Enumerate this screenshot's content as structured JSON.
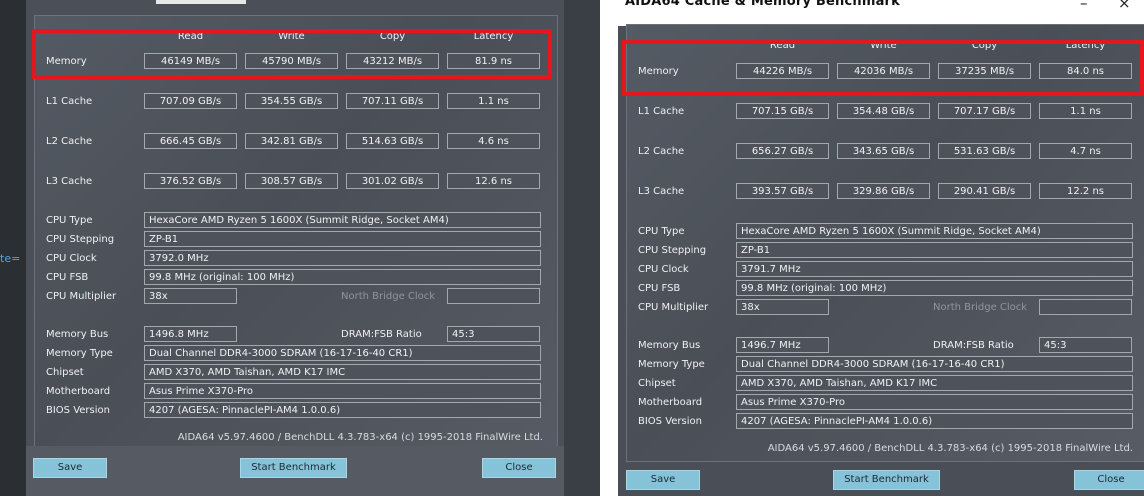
{
  "window": {
    "title": "AIDA64 Cache & Memory Benchmark",
    "minimize": "–",
    "close": "×"
  },
  "left_gutter_text": "te=",
  "columns": [
    "Read",
    "Write",
    "Copy",
    "Latency"
  ],
  "row_labels": [
    "Memory",
    "L1 Cache",
    "L2 Cache",
    "L3 Cache"
  ],
  "info_labels": {
    "cpu_type": "CPU Type",
    "cpu_stepping": "CPU Stepping",
    "cpu_clock": "CPU Clock",
    "cpu_fsb": "CPU FSB",
    "cpu_multiplier": "CPU Multiplier",
    "north_bridge_clock": "North Bridge Clock",
    "memory_bus": "Memory Bus",
    "dram_fsb_ratio": "DRAM:FSB Ratio",
    "memory_type": "Memory Type",
    "chipset": "Chipset",
    "motherboard": "Motherboard",
    "bios_version": "BIOS Version"
  },
  "buttons": {
    "save": "Save",
    "start": "Start Benchmark",
    "close": "Close"
  },
  "left": {
    "results": [
      [
        "46149 MB/s",
        "45790 MB/s",
        "43212 MB/s",
        "81.9 ns"
      ],
      [
        "707.09 GB/s",
        "354.55 GB/s",
        "707.11 GB/s",
        "1.1 ns"
      ],
      [
        "666.45 GB/s",
        "342.81 GB/s",
        "514.63 GB/s",
        "4.6 ns"
      ],
      [
        "376.52 GB/s",
        "308.57 GB/s",
        "301.02 GB/s",
        "12.6 ns"
      ]
    ],
    "info": {
      "cpu_type": "HexaCore AMD Ryzen 5 1600X  (Summit Ridge, Socket AM4)",
      "cpu_stepping": "ZP-B1",
      "cpu_clock": "3792.0 MHz",
      "cpu_fsb": "99.8 MHz  (original: 100 MHz)",
      "cpu_multiplier": "38x",
      "north_bridge_clock": "",
      "memory_bus": "1496.8 MHz",
      "dram_fsb_ratio": "45:3",
      "memory_type": "Dual Channel DDR4-3000 SDRAM  (16-17-16-40 CR1)",
      "chipset": "AMD X370, AMD Taishan, AMD K17 IMC",
      "motherboard": "Asus Prime X370-Pro",
      "bios_version": "4207  (AGESA: PinnaclePI-AM4 1.0.0.6)"
    },
    "copyright": "AIDA64 v5.97.4600 / BenchDLL 4.3.783-x64  (c) 1995-2018 FinalWire Ltd."
  },
  "right": {
    "results": [
      [
        "44226 MB/s",
        "42036 MB/s",
        "37235 MB/s",
        "84.0 ns"
      ],
      [
        "707.15 GB/s",
        "354.48 GB/s",
        "707.17 GB/s",
        "1.1 ns"
      ],
      [
        "656.27 GB/s",
        "343.65 GB/s",
        "531.63 GB/s",
        "4.7 ns"
      ],
      [
        "393.57 GB/s",
        "329.86 GB/s",
        "290.41 GB/s",
        "12.2 ns"
      ]
    ],
    "info": {
      "cpu_type": "HexaCore AMD Ryzen 5 1600X  (Summit Ridge, Socket AM4)",
      "cpu_stepping": "ZP-B1",
      "cpu_clock": "3791.7 MHz",
      "cpu_fsb": "99.8 MHz  (original: 100 MHz)",
      "cpu_multiplier": "38x",
      "north_bridge_clock": "",
      "memory_bus": "1496.7 MHz",
      "dram_fsb_ratio": "45:3",
      "memory_type": "Dual Channel DDR4-3000 SDRAM  (16-17-16-40 CR1)",
      "chipset": "AMD X370, AMD Taishan, AMD K17 IMC",
      "motherboard": "Asus Prime X370-Pro",
      "bios_version": "4207  (AGESA: PinnaclePI-AM4 1.0.0.6)"
    },
    "copyright": "AIDA64 v5.97.4600 / BenchDLL 4.3.783-x64  (c) 1995-2018 FinalWire Ltd."
  },
  "colors": {
    "highlight": "#e4161e",
    "button": "#86c2d8",
    "panel": "#4a4f57"
  }
}
